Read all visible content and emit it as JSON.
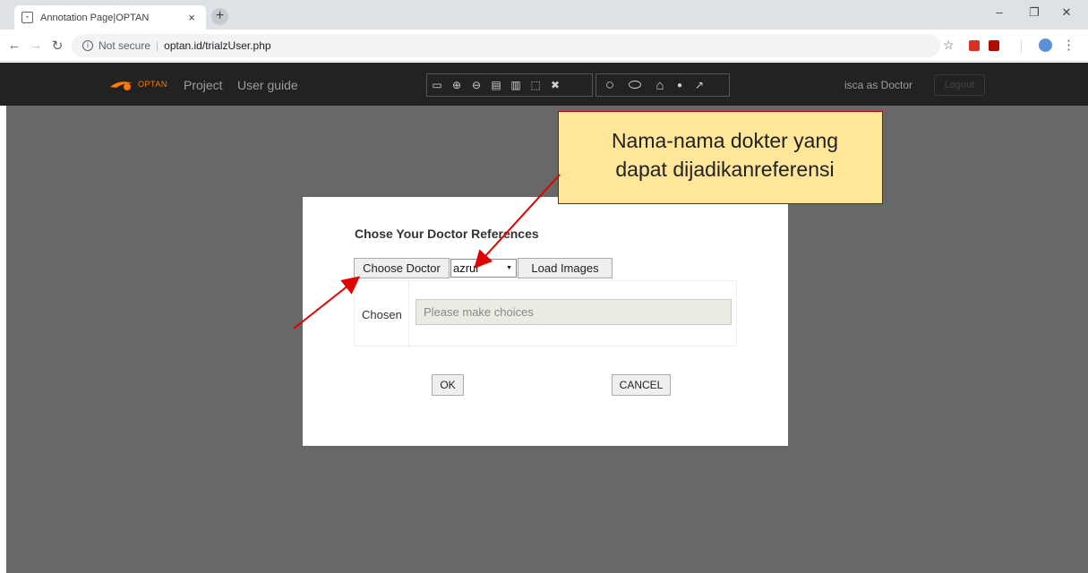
{
  "browser": {
    "tab_title": "Annotation Page|OPTAN",
    "not_secure": "Not secure",
    "url": "optan.id/trialzUser.php"
  },
  "appbar": {
    "logo_text": "OPTAN",
    "nav": [
      "Project",
      "User guide"
    ],
    "user_label": "isca as Doctor",
    "logout_label": "Logout",
    "tools_group1": [
      "folder-icon",
      "zoom-in-icon",
      "zoom-out-icon",
      "copy-icon",
      "paste-icon",
      "select-icon",
      "delete-icon"
    ],
    "tools_group2": [
      "circle-icon",
      "ellipse-icon",
      "polygon-icon",
      "point-icon",
      "freehand-icon"
    ]
  },
  "modal": {
    "title": "Chose Your Doctor References",
    "choose_doctor_label": "Choose Doctor",
    "doctor_selected": "azrul",
    "load_images_label": "Load Images",
    "chosen_label": "Chosen",
    "chosen_placeholder": "Please make choices",
    "ok_label": "OK",
    "cancel_label": "CANCEL"
  },
  "callout": {
    "line1": "Nama-nama dokter yang",
    "line2": "dapat dijadikanreferensi"
  },
  "colors": {
    "overlay": "#686868",
    "appbar": "#222222",
    "callout_fill": "#ffe699",
    "callout_border": "#c00000",
    "arrow": "#e00000"
  }
}
